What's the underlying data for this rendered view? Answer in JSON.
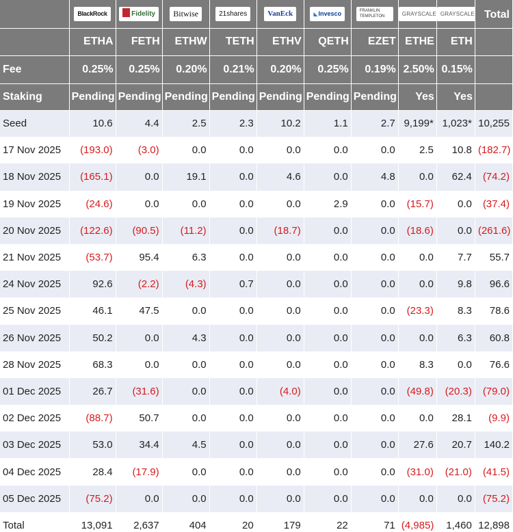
{
  "header": {
    "total_label": "Total",
    "fee_label": "Fee",
    "staking_label": "Staking"
  },
  "funds": [
    {
      "issuer": "BlackRock",
      "ticker": "ETHA",
      "fee": "0.25%",
      "staking": "Pending"
    },
    {
      "issuer": "Fidelity",
      "ticker": "FETH",
      "fee": "0.25%",
      "staking": "Pending"
    },
    {
      "issuer": "Bitwise",
      "ticker": "ETHW",
      "fee": "0.20%",
      "staking": "Pending"
    },
    {
      "issuer": "21shares",
      "ticker": "TETH",
      "fee": "0.21%",
      "staking": "Pending"
    },
    {
      "issuer": "VanEck",
      "ticker": "ETHV",
      "fee": "0.20%",
      "staking": "Pending"
    },
    {
      "issuer": "Invesco",
      "ticker": "QETH",
      "fee": "0.25%",
      "staking": "Pending"
    },
    {
      "issuer": "FRANKLIN TEMPLETON",
      "ticker": "EZET",
      "fee": "0.19%",
      "staking": "Pending"
    },
    {
      "issuer": "GRAYSCALE",
      "ticker": "ETHE",
      "fee": "2.50%",
      "staking": "Yes"
    },
    {
      "issuer": "GRAYSCALE",
      "ticker": "ETH",
      "fee": "0.15%",
      "staking": "Yes"
    }
  ],
  "rows": [
    {
      "label": "Seed",
      "values": [
        "10.6",
        "4.4",
        "2.5",
        "2.3",
        "10.2",
        "1.1",
        "2.7",
        "9,199*",
        "1,023*",
        "10,255"
      ]
    },
    {
      "label": "17 Nov 2025",
      "values": [
        "(193.0)",
        "(3.0)",
        "0.0",
        "0.0",
        "0.0",
        "0.0",
        "0.0",
        "2.5",
        "10.8",
        "(182.7)"
      ]
    },
    {
      "label": "18 Nov 2025",
      "values": [
        "(165.1)",
        "0.0",
        "19.1",
        "0.0",
        "4.6",
        "0.0",
        "4.8",
        "0.0",
        "62.4",
        "(74.2)"
      ]
    },
    {
      "label": "19 Nov 2025",
      "values": [
        "(24.6)",
        "0.0",
        "0.0",
        "0.0",
        "0.0",
        "2.9",
        "0.0",
        "(15.7)",
        "0.0",
        "(37.4)"
      ]
    },
    {
      "label": "20 Nov 2025",
      "values": [
        "(122.6)",
        "(90.5)",
        "(11.2)",
        "0.0",
        "(18.7)",
        "0.0",
        "0.0",
        "(18.6)",
        "0.0",
        "(261.6)"
      ]
    },
    {
      "label": "21 Nov 2025",
      "values": [
        "(53.7)",
        "95.4",
        "6.3",
        "0.0",
        "0.0",
        "0.0",
        "0.0",
        "0.0",
        "7.7",
        "55.7"
      ]
    },
    {
      "label": "24 Nov 2025",
      "values": [
        "92.6",
        "(2.2)",
        "(4.3)",
        "0.7",
        "0.0",
        "0.0",
        "0.0",
        "0.0",
        "9.8",
        "96.6"
      ]
    },
    {
      "label": "25 Nov 2025",
      "values": [
        "46.1",
        "47.5",
        "0.0",
        "0.0",
        "0.0",
        "0.0",
        "0.0",
        "(23.3)",
        "8.3",
        "78.6"
      ]
    },
    {
      "label": "26 Nov 2025",
      "values": [
        "50.2",
        "0.0",
        "4.3",
        "0.0",
        "0.0",
        "0.0",
        "0.0",
        "0.0",
        "6.3",
        "60.8"
      ]
    },
    {
      "label": "28 Nov 2025",
      "values": [
        "68.3",
        "0.0",
        "0.0",
        "0.0",
        "0.0",
        "0.0",
        "0.0",
        "8.3",
        "0.0",
        "76.6"
      ]
    },
    {
      "label": "01 Dec 2025",
      "values": [
        "26.7",
        "(31.6)",
        "0.0",
        "0.0",
        "(4.0)",
        "0.0",
        "0.0",
        "(49.8)",
        "(20.3)",
        "(79.0)"
      ]
    },
    {
      "label": "02 Dec 2025",
      "values": [
        "(88.7)",
        "50.7",
        "0.0",
        "0.0",
        "0.0",
        "0.0",
        "0.0",
        "0.0",
        "28.1",
        "(9.9)"
      ]
    },
    {
      "label": "03 Dec 2025",
      "values": [
        "53.0",
        "34.4",
        "4.5",
        "0.0",
        "0.0",
        "0.0",
        "0.0",
        "27.6",
        "20.7",
        "140.2"
      ]
    },
    {
      "label": "04 Dec 2025",
      "values": [
        "28.4",
        "(17.9)",
        "0.0",
        "0.0",
        "0.0",
        "0.0",
        "0.0",
        "(31.0)",
        "(21.0)",
        "(41.5)"
      ]
    },
    {
      "label": "05 Dec 2025",
      "values": [
        "(75.2)",
        "0.0",
        "0.0",
        "0.0",
        "0.0",
        "0.0",
        "0.0",
        "0.0",
        "0.0",
        "(75.2)"
      ]
    },
    {
      "label": "Total",
      "values": [
        "13,091",
        "2,637",
        "404",
        "20",
        "179",
        "22",
        "71",
        "(4,985)",
        "1,460",
        "12,898"
      ]
    }
  ],
  "colors": {
    "header_bg": "#7b7b7b",
    "band_bg": "#e9ecf4",
    "negative": "#d7191c"
  }
}
